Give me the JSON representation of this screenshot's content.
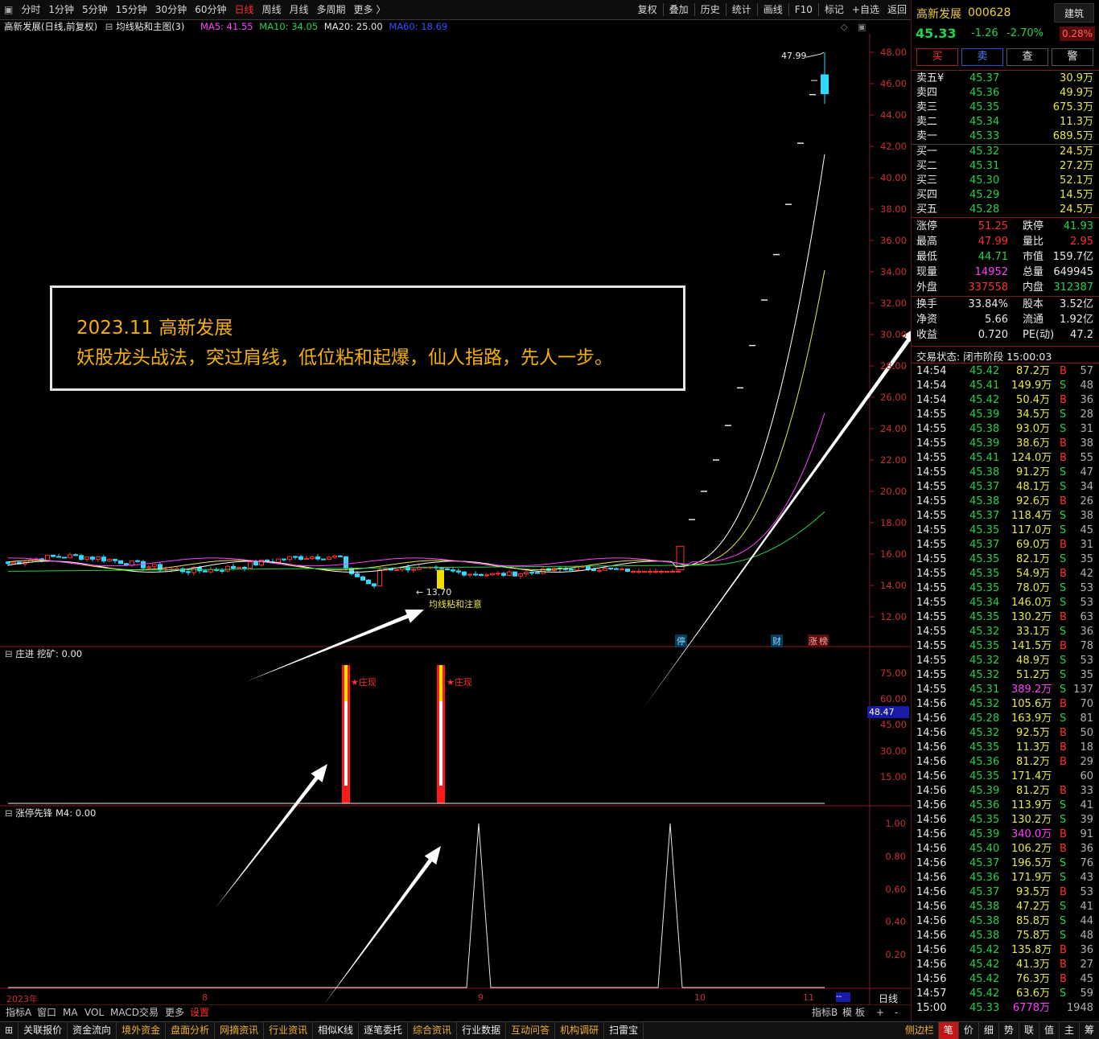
{
  "toolbar": {
    "periods": [
      "分时",
      "1分钟",
      "5分钟",
      "15分钟",
      "30分钟",
      "60分钟",
      "日线",
      "周线",
      "月线",
      "多周期",
      "更多 〉"
    ],
    "active_period": "日线",
    "right_buttons": [
      "复权",
      "叠加",
      "历史",
      "统计",
      "画线",
      "F10",
      "标记",
      "+自选",
      "返回"
    ]
  },
  "chart_header": {
    "title": "高新发展(日线,前复权)",
    "indicator": "均线粘和主图(3)",
    "ma5_label": "MA5: 41.55",
    "ma10_label": "MA10: 34.05",
    "ma20_label": "MA20: 25.00",
    "ma60_label": "MA60: 18.69"
  },
  "main_axis": [
    "48.00",
    "46.00",
    "44.00",
    "42.00",
    "40.00",
    "38.00",
    "36.00",
    "34.00",
    "32.00",
    "30.00",
    "28.00",
    "26.00",
    "24.00",
    "22.00",
    "20.00",
    "18.00",
    "16.00",
    "14.00",
    "12.00"
  ],
  "main_annotations": {
    "high_label": "47.99",
    "low_label": "13.70",
    "pattern_label": "均线粘和注意",
    "badges": [
      "停",
      "财",
      "涨",
      "榜"
    ]
  },
  "annotation_box": {
    "line1": "2023.11 高新发展",
    "line2": "妖股龙头战法，突过肩线，低位粘和起爆，仙人指路，先人一步。"
  },
  "sub1": {
    "header": "庄进  挖矿: 0.00",
    "axis": [
      "75.00",
      "60.00",
      "45.00",
      "30.00",
      "15.00"
    ],
    "current_value": "48.47",
    "signal_label": "★庄现"
  },
  "sub2": {
    "header": "涨停先锋  M4: 0.00",
    "axis": [
      "1.00",
      "0.80",
      "0.60",
      "0.40",
      "0.20"
    ]
  },
  "xaxis": {
    "labels": [
      "2023年",
      "8",
      "9",
      "10",
      "11"
    ],
    "period_label": "日线"
  },
  "subbar": {
    "left": [
      "指标A",
      "窗口",
      "MA",
      "VOL",
      "MACD交易",
      "更多",
      "设置"
    ],
    "right": [
      "指标B",
      "模",
      "板",
      "+",
      "-"
    ]
  },
  "quote": {
    "name": "高新发展",
    "code": "000628",
    "sector": "建筑",
    "price": "45.33",
    "change": "-1.26",
    "change_pct": "-2.70%",
    "diff_pct": "0.28%",
    "buttons": [
      "买",
      "卖",
      "查",
      "警"
    ],
    "asks": [
      {
        "label": "卖五¥",
        "price": "45.37",
        "vol": "30.9万"
      },
      {
        "label": "卖四",
        "price": "45.36",
        "vol": "49.9万"
      },
      {
        "label": "卖三",
        "price": "45.35",
        "vol": "675.3万"
      },
      {
        "label": "卖二",
        "price": "45.34",
        "vol": "11.3万"
      },
      {
        "label": "卖一",
        "price": "45.33",
        "vol": "689.5万"
      }
    ],
    "bids": [
      {
        "label": "买一",
        "price": "45.32",
        "vol": "24.5万"
      },
      {
        "label": "买二",
        "price": "45.31",
        "vol": "27.2万"
      },
      {
        "label": "买三",
        "price": "45.30",
        "vol": "52.1万"
      },
      {
        "label": "买四",
        "price": "45.29",
        "vol": "14.5万"
      },
      {
        "label": "买五",
        "price": "45.28",
        "vol": "24.5万"
      }
    ],
    "stats": [
      {
        "l1": "涨停",
        "v1": "51.25",
        "l2": "跌停",
        "v2": "41.93"
      },
      {
        "l1": "最高",
        "v1": "47.99",
        "l2": "量比",
        "v2": "2.95"
      },
      {
        "l1": "最低",
        "v1": "44.71",
        "l2": "市值",
        "v2": "159.7亿"
      },
      {
        "l1": "现量",
        "v1": "14952",
        "l2": "总量",
        "v2": "649945"
      },
      {
        "l1": "外盘",
        "v1": "337558",
        "l2": "内盘",
        "v2": "312387"
      }
    ],
    "stats2": [
      {
        "l1": "换手",
        "v1": "33.84%",
        "l2": "股本",
        "v2": "3.52亿"
      },
      {
        "l1": "净资",
        "v1": "5.66",
        "l2": "流通",
        "v2": "1.92亿"
      },
      {
        "l1": "收益",
        "v1": "0.720",
        "l2": "PE(动)",
        "v2": "47.2"
      }
    ],
    "trade_status": "交易状态: 闭市阶段 15:00:03"
  },
  "ticks": [
    [
      "14:54",
      "45.42",
      "87.2万",
      "B",
      "57"
    ],
    [
      "14:54",
      "45.41",
      "149.9万",
      "S",
      "48"
    ],
    [
      "14:54",
      "45.42",
      "50.4万",
      "B",
      "36"
    ],
    [
      "14:55",
      "45.39",
      "34.5万",
      "S",
      "28"
    ],
    [
      "14:55",
      "45.38",
      "93.0万",
      "S",
      "31"
    ],
    [
      "14:55",
      "45.39",
      "38.6万",
      "B",
      "38"
    ],
    [
      "14:55",
      "45.41",
      "124.0万",
      "B",
      "55"
    ],
    [
      "14:55",
      "45.38",
      "91.2万",
      "S",
      "47"
    ],
    [
      "14:55",
      "45.37",
      "48.1万",
      "S",
      "34"
    ],
    [
      "14:55",
      "45.38",
      "92.6万",
      "B",
      "26"
    ],
    [
      "14:55",
      "45.37",
      "118.4万",
      "S",
      "38"
    ],
    [
      "14:55",
      "45.35",
      "117.0万",
      "S",
      "45"
    ],
    [
      "14:55",
      "45.37",
      "69.0万",
      "B",
      "31"
    ],
    [
      "14:55",
      "45.35",
      "82.1万",
      "S",
      "35"
    ],
    [
      "14:55",
      "45.35",
      "54.9万",
      "B",
      "42"
    ],
    [
      "14:55",
      "45.35",
      "78.0万",
      "S",
      "53"
    ],
    [
      "14:55",
      "45.34",
      "146.0万",
      "S",
      "53"
    ],
    [
      "14:55",
      "45.35",
      "130.2万",
      "B",
      "63"
    ],
    [
      "14:55",
      "45.32",
      "33.1万",
      "S",
      "36"
    ],
    [
      "14:55",
      "45.35",
      "141.5万",
      "B",
      "78"
    ],
    [
      "14:55",
      "45.32",
      "48.9万",
      "S",
      "53"
    ],
    [
      "14:55",
      "45.32",
      "51.2万",
      "S",
      "35"
    ],
    [
      "14:55",
      "45.31",
      "389.2万",
      "S",
      "137"
    ],
    [
      "14:56",
      "45.32",
      "105.6万",
      "B",
      "70"
    ],
    [
      "14:56",
      "45.28",
      "163.9万",
      "S",
      "81"
    ],
    [
      "14:56",
      "45.32",
      "92.5万",
      "B",
      "50"
    ],
    [
      "14:56",
      "45.35",
      "11.3万",
      "B",
      "18"
    ],
    [
      "14:56",
      "45.36",
      "81.2万",
      "B",
      "29"
    ],
    [
      "14:56",
      "45.35",
      "171.4万",
      "",
      "60"
    ],
    [
      "14:56",
      "45.39",
      "81.2万",
      "B",
      "33"
    ],
    [
      "14:56",
      "45.36",
      "113.9万",
      "S",
      "41"
    ],
    [
      "14:56",
      "45.35",
      "130.2万",
      "S",
      "39"
    ],
    [
      "14:56",
      "45.39",
      "340.0万",
      "B",
      "91"
    ],
    [
      "14:56",
      "45.40",
      "106.2万",
      "B",
      "36"
    ],
    [
      "14:56",
      "45.37",
      "196.5万",
      "S",
      "76"
    ],
    [
      "14:56",
      "45.36",
      "171.9万",
      "S",
      "43"
    ],
    [
      "14:56",
      "45.37",
      "93.5万",
      "B",
      "53"
    ],
    [
      "14:56",
      "45.38",
      "47.2万",
      "S",
      "41"
    ],
    [
      "14:56",
      "45.38",
      "85.8万",
      "S",
      "44"
    ],
    [
      "14:56",
      "45.38",
      "75.8万",
      "S",
      "48"
    ],
    [
      "14:56",
      "45.42",
      "135.8万",
      "B",
      "36"
    ],
    [
      "14:56",
      "45.42",
      "41.3万",
      "B",
      "27"
    ],
    [
      "14:56",
      "45.42",
      "76.3万",
      "B",
      "45"
    ],
    [
      "14:57",
      "45.42",
      "63.6万",
      "S",
      "59"
    ],
    [
      "15:00",
      "45.33",
      "6778万",
      "",
      "1948"
    ]
  ],
  "bottom_bar": {
    "items": [
      "关联报价",
      "资金流向",
      "境外资金",
      "盘面分析",
      "网摘资讯",
      "行业资讯",
      "相似K线",
      "逐笔委托",
      "综合资讯",
      "行业数据",
      "互动问答",
      "机构调研",
      "扫雷宝"
    ],
    "right_tabs": [
      "侧边栏",
      "笔",
      "价",
      "细",
      "势",
      "联",
      "值",
      "主",
      "筹"
    ]
  },
  "colors": {
    "up": "#ff3030",
    "down": "#21d34c",
    "ma5": "#ffffff",
    "ma10": "#e8e84a",
    "ma20": "#ff40ff",
    "ma60": "#21d34c",
    "axis": "#c83030"
  }
}
